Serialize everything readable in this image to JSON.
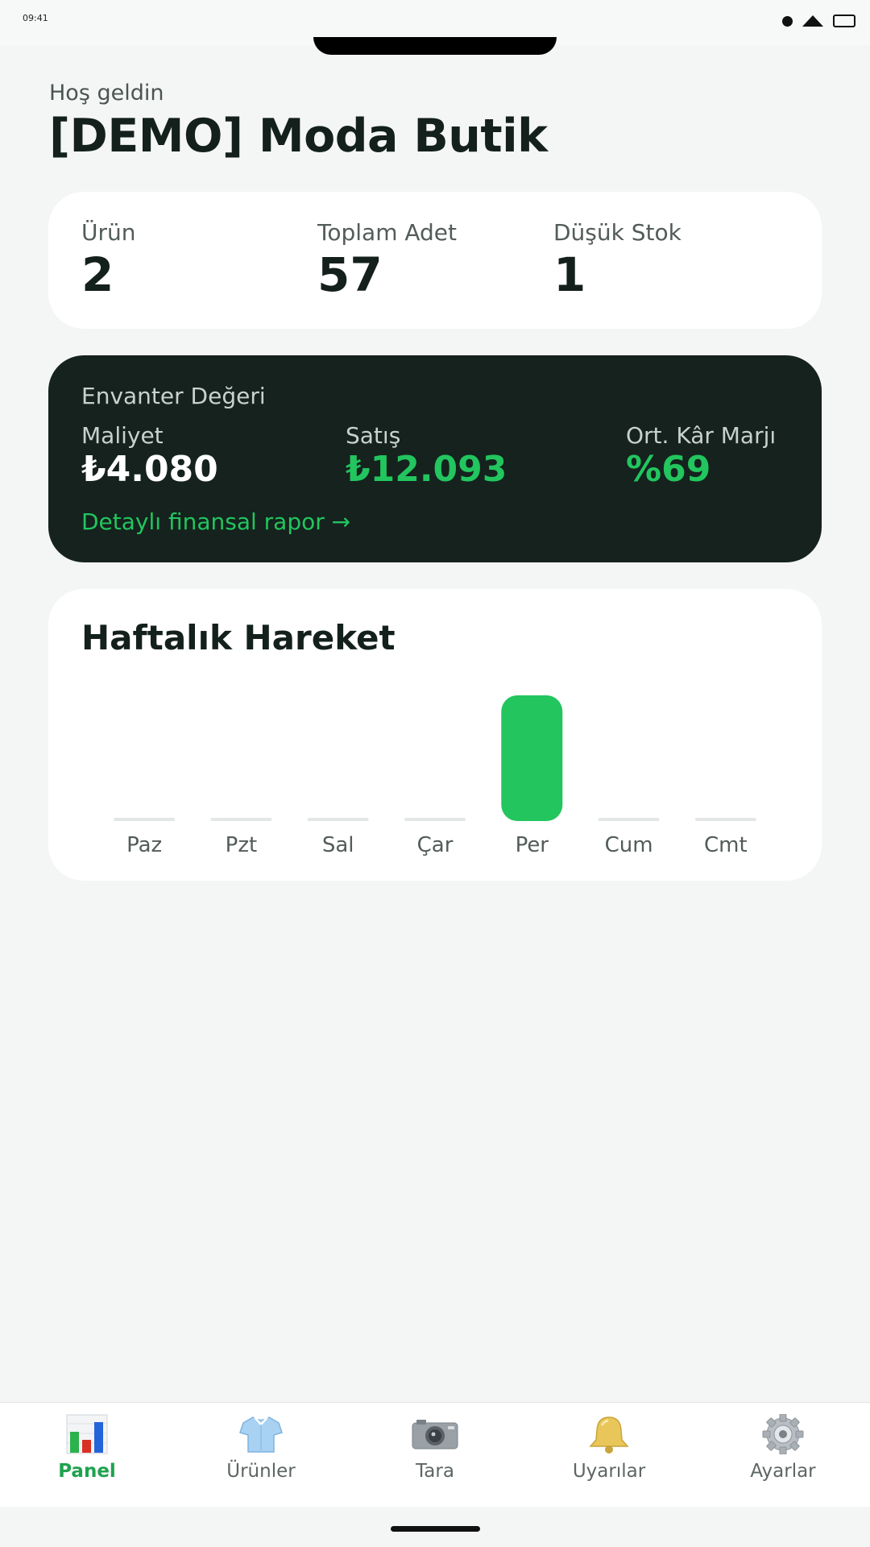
{
  "status": {
    "time": "09:41"
  },
  "header": {
    "greeting": "Hoş geldin",
    "store_name": "[DEMO] Moda Butik"
  },
  "stats": [
    {
      "label": "Ürün",
      "value": "2"
    },
    {
      "label": "Toplam Adet",
      "value": "57"
    },
    {
      "label": "Düşük Stok",
      "value": "1"
    }
  ],
  "inventory": {
    "title": "Envanter Değeri",
    "cost_label": "Maliyet",
    "cost_value": "₺4.080",
    "sales_label": "Satış",
    "sales_value": "₺12.093",
    "margin_label": "Ort. Kâr Marjı",
    "margin_value": "%69",
    "link": "Detaylı finansal rapor →"
  },
  "weekly": {
    "title": "Haftalık Hareket"
  },
  "chart_data": {
    "type": "bar",
    "title": "Haftalık Hareket",
    "categories": [
      "Paz",
      "Pzt",
      "Sal",
      "Çar",
      "Per",
      "Cum",
      "Cmt"
    ],
    "values": [
      0,
      0,
      0,
      0,
      1,
      0,
      0
    ],
    "ylim": [
      0,
      1
    ],
    "grid": false,
    "bar_color": "#22c55e",
    "empty_color": "#e3e8e6"
  },
  "tabs": [
    {
      "label": "Panel",
      "icon": "bar-chart-icon",
      "active": true
    },
    {
      "label": "Ürünler",
      "icon": "shirt-icon",
      "active": false
    },
    {
      "label": "Tara",
      "icon": "camera-icon",
      "active": false
    },
    {
      "label": "Uyarılar",
      "icon": "bell-icon",
      "active": false
    },
    {
      "label": "Ayarlar",
      "icon": "gear-icon",
      "active": false
    }
  ],
  "colors": {
    "accent": "#22c55e",
    "dark_card": "#15221e",
    "background": "#f4f6f5"
  }
}
